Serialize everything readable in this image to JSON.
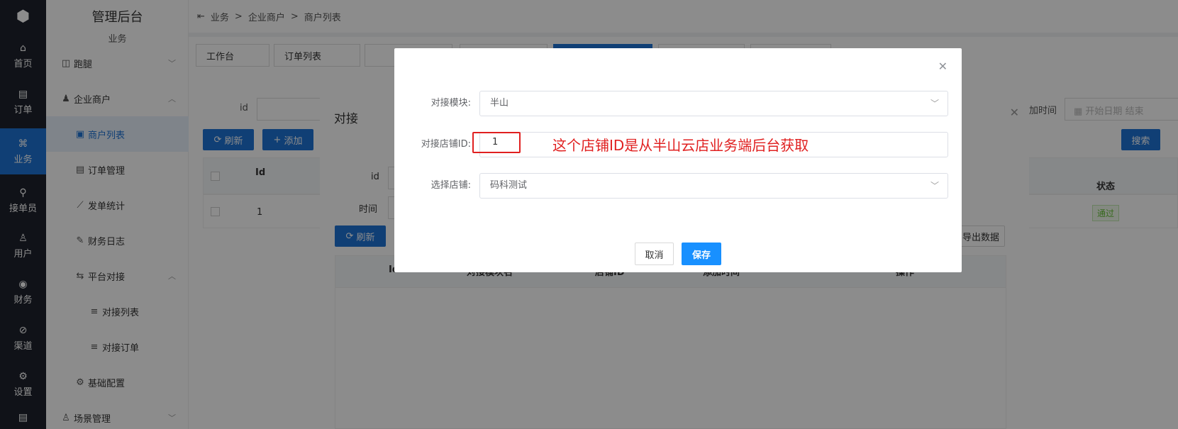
{
  "rail": {
    "logo": "⬢",
    "items": [
      {
        "icon": "⌂",
        "label": "首页"
      },
      {
        "icon": "▤",
        "label": "订单"
      },
      {
        "icon": "⌘",
        "label": "业务"
      },
      {
        "icon": "⚲",
        "label": "接单员"
      },
      {
        "icon": "♙",
        "label": "用户"
      },
      {
        "icon": "◉",
        "label": "财务"
      },
      {
        "icon": "⊘",
        "label": "渠道"
      },
      {
        "icon": "⚙",
        "label": "设置"
      },
      {
        "icon": "▤",
        "label": ""
      }
    ]
  },
  "sidebar": {
    "title": "管理后台",
    "subtitle": "业务",
    "items": [
      {
        "icon": "◫",
        "label": "跑腿"
      },
      {
        "icon": "♟",
        "label": "企业商户"
      },
      {
        "icon": "▣",
        "label": "商户列表"
      },
      {
        "icon": "▤",
        "label": "订单管理"
      },
      {
        "icon": "⟋",
        "label": "发单统计"
      },
      {
        "icon": "✎",
        "label": "财务日志"
      },
      {
        "icon": "⇆",
        "label": "平台对接"
      },
      {
        "icon": "≡",
        "label": "对接列表"
      },
      {
        "icon": "≡",
        "label": "对接订单"
      },
      {
        "icon": "⚙",
        "label": "基础配置"
      },
      {
        "icon": "♙",
        "label": "场景管理"
      }
    ]
  },
  "breadcrumb": {
    "toggle": "⇤",
    "b1": "业务",
    "sep": ">",
    "b2": "企业商户",
    "b3": "商户列表"
  },
  "tabs": [
    "工作台",
    "订单列表"
  ],
  "page": {
    "id_label": "id",
    "refresh": "刷新",
    "add": "添加",
    "time_suffix": "加时间",
    "start_date": "开始日期",
    "end_date": "结束",
    "search": "搜索",
    "col_id": "Id",
    "col_status": "状态",
    "row_id": "1",
    "row_status": "通过"
  },
  "inner_dialog": {
    "title": "对接",
    "id_label": "id",
    "time_label": "时间",
    "refresh": "刷新",
    "export": "导出数据",
    "cols": [
      "Id",
      "对接模块名",
      "店铺ID",
      "添加时间",
      "操作"
    ]
  },
  "dialog": {
    "module_label": "对接模块:",
    "module_value": "半山",
    "shop_id_label": "对接店铺ID:",
    "shop_id_value": "1",
    "annotation": "这个店铺ID是从半山云店业务端后台获取",
    "shop_label": "选择店铺:",
    "shop_value": "码科测试",
    "cancel": "取消",
    "save": "保存"
  },
  "colors": {
    "primary": "#1e73d6",
    "save": "#1890ff",
    "annotation": "#e02020",
    "rail_bg": "#1e222d"
  }
}
